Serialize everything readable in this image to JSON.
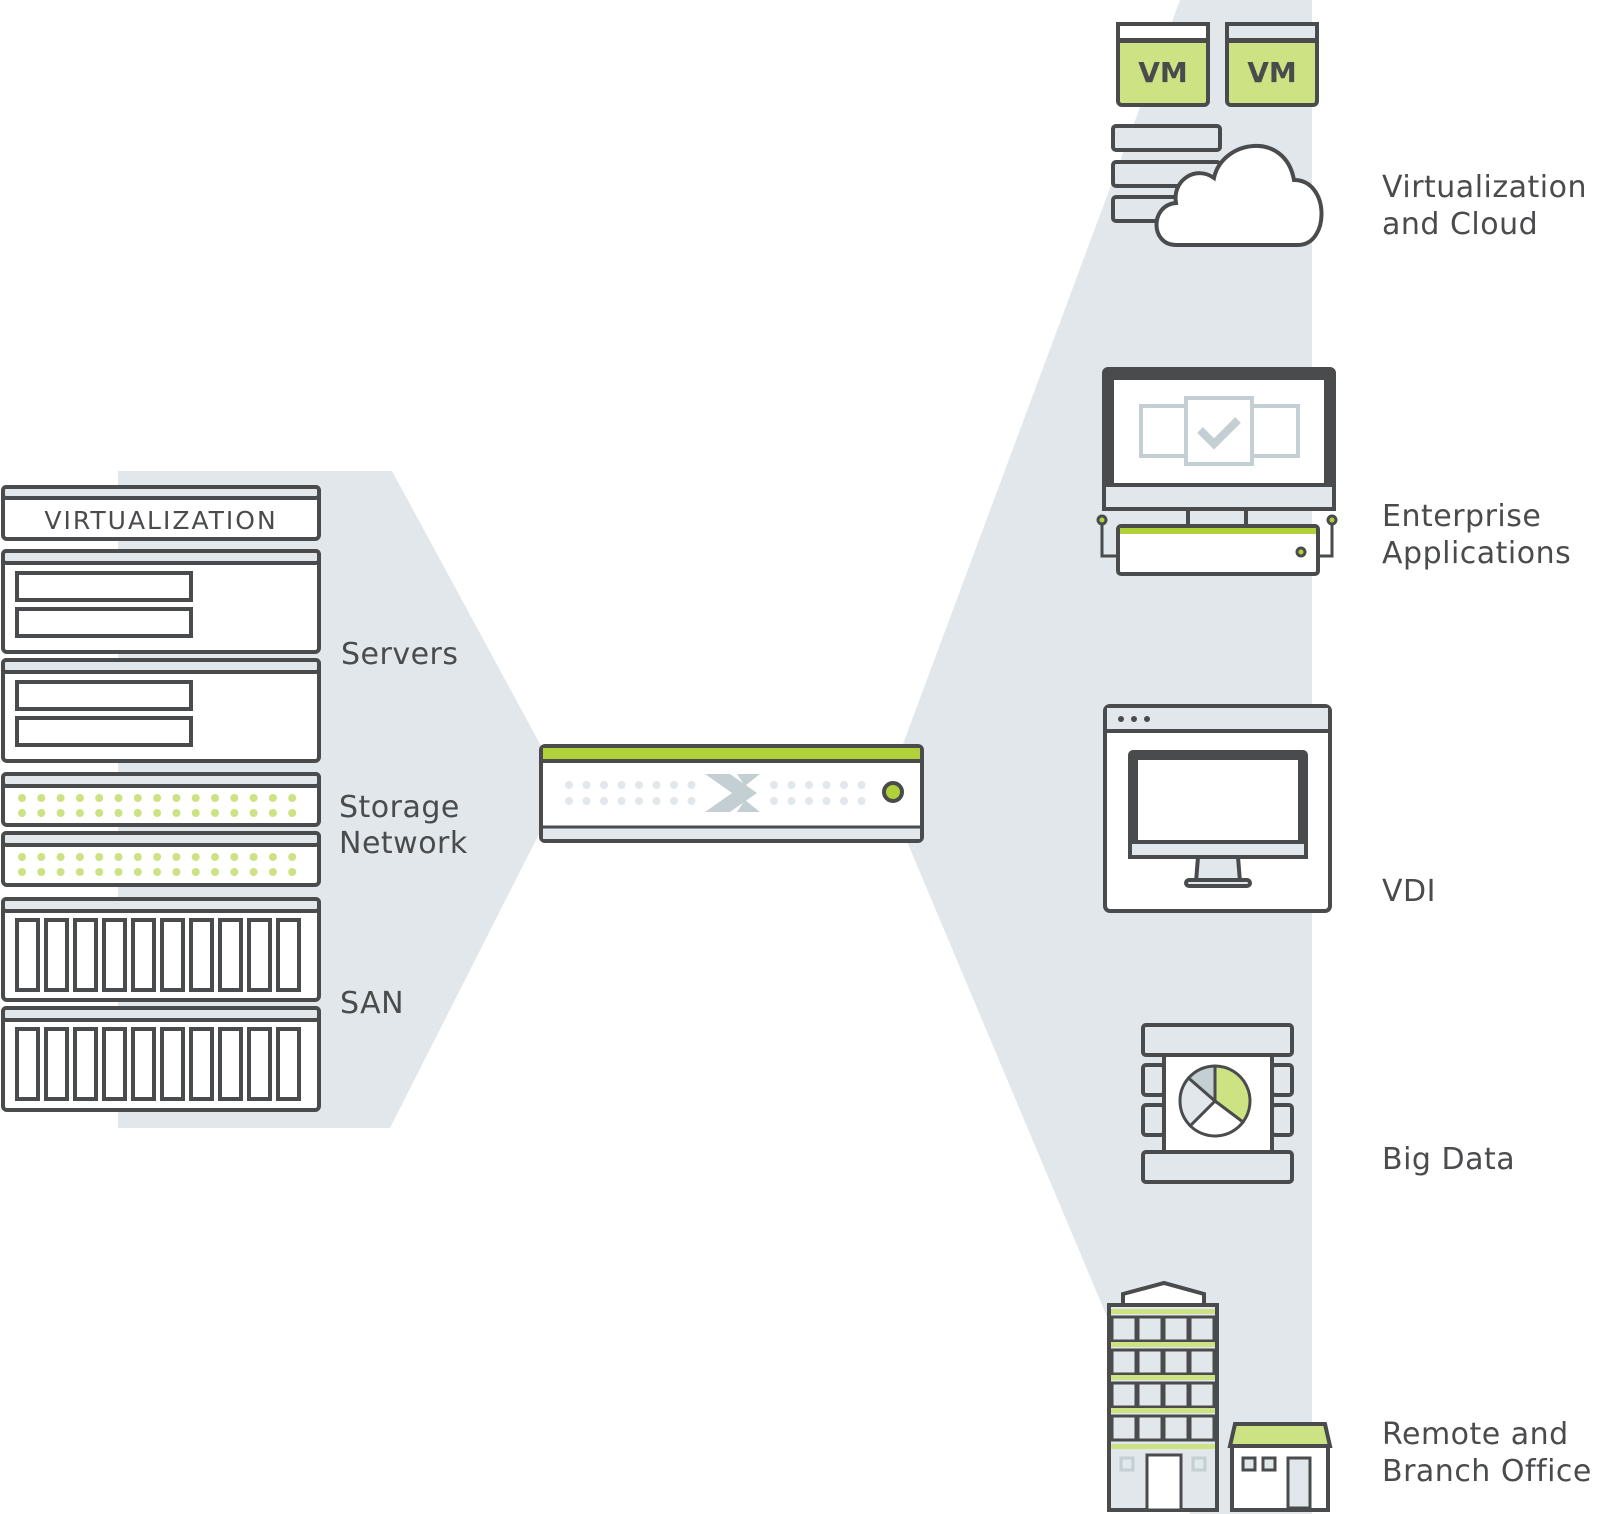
{
  "colors": {
    "outline": "#4a4b4d",
    "fan": "#e1e7ea",
    "accent_green": "#b1d13a",
    "light_green": "#cde283",
    "icon_gray": "#c4cfd4",
    "panel_light": "#e1e7ea",
    "white": "#ffffff"
  },
  "left_stack": {
    "virtualization_label": "VIRTUALIZATION",
    "servers_label": "Servers",
    "storage_label_line1": "Storage",
    "storage_label_line2": "Network",
    "san_label": "SAN",
    "server_units": 2,
    "storage_units": 2,
    "san_units": 2,
    "san_drive_bays_per_unit": 10,
    "storage_led_columns": 15
  },
  "center_appliance": {
    "logo_icon": "nutanix-x-logo",
    "status_led": "on"
  },
  "use_cases": [
    {
      "id": "virtualization-cloud",
      "line1": "Virtualization",
      "line2": "and Cloud",
      "icon": "vm-cloud-icon",
      "vm_labels": [
        "VM",
        "VM"
      ]
    },
    {
      "id": "enterprise-applications",
      "line1": "Enterprise",
      "line2": "Applications",
      "icon": "monitor-apps-icon"
    },
    {
      "id": "vdi",
      "line1": "VDI",
      "line2": "",
      "icon": "desktop-window-icon"
    },
    {
      "id": "big-data",
      "line1": "Big Data",
      "line2": "",
      "icon": "pie-chart-server-icon"
    },
    {
      "id": "remote-branch-office",
      "line1": "Remote and",
      "line2": "Branch Office",
      "icon": "buildings-icon"
    }
  ]
}
